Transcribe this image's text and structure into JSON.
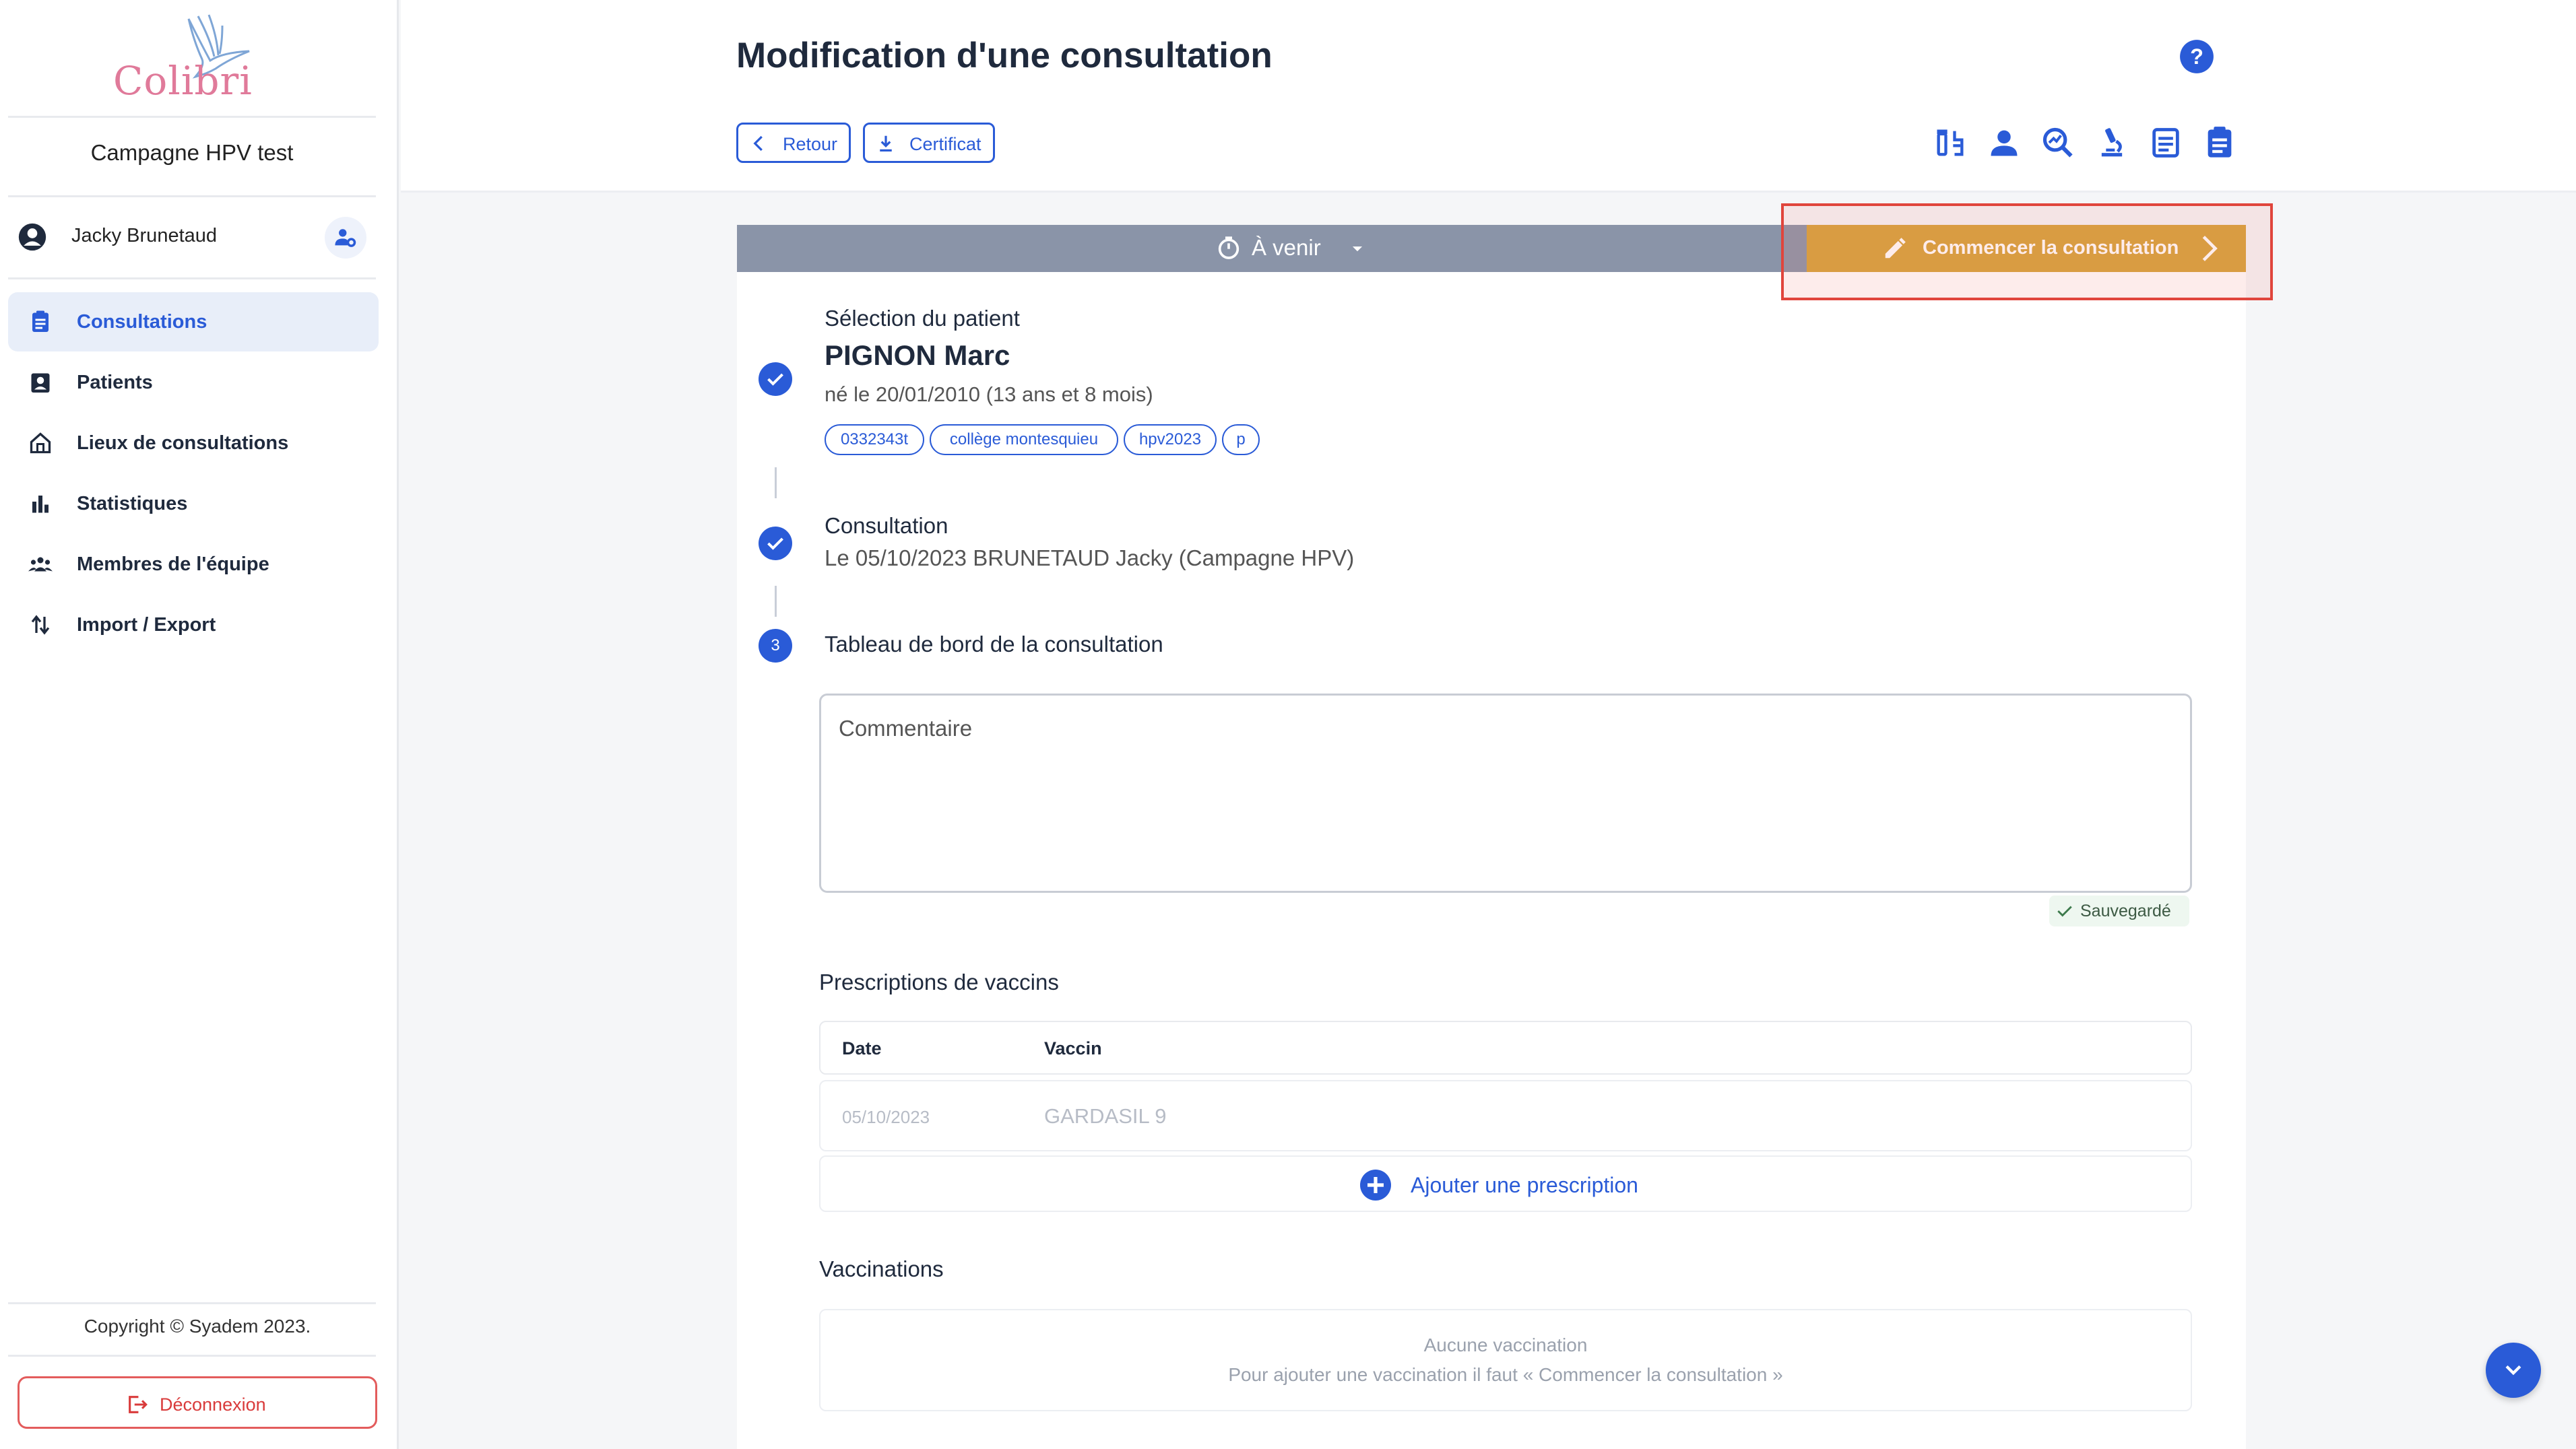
{
  "app": {
    "logo_text": "Colibri",
    "campaign": "Campagne HPV test",
    "user_name": "Jacky Brunetaud",
    "copyright": "Copyright © Syadem 2023.",
    "logout_label": "Déconnexion"
  },
  "sidebar": {
    "items": [
      {
        "label": "Consultations",
        "icon": "clipboard-icon",
        "active": true
      },
      {
        "label": "Patients",
        "icon": "patient-badge-icon"
      },
      {
        "label": "Lieux de consultations",
        "icon": "home-icon"
      },
      {
        "label": "Statistiques",
        "icon": "bar-chart-icon"
      },
      {
        "label": "Membres de l'équipe",
        "icon": "team-icon"
      },
      {
        "label": "Import / Export",
        "icon": "swap-arrows-icon"
      }
    ]
  },
  "header": {
    "title": "Modification d'une consultation",
    "back_label": "Retour",
    "certificate_label": "Certificat",
    "toolbar_icons": [
      "vaccine-icon",
      "person-icon",
      "search-analytics-icon",
      "microscope-icon",
      "document-icon",
      "clipboard-list-icon"
    ]
  },
  "status": {
    "label": "À venir",
    "start_label": "Commencer la consultation"
  },
  "colors": {
    "accent": "#2a5bd7",
    "status_bar": "#8a94a8",
    "start_button": "#d6a23b",
    "highlight": "#e0453c"
  },
  "patient_step": {
    "title": "Sélection du patient",
    "name": "PIGNON Marc",
    "birth": "né le 20/01/2010 (13 ans et 8 mois)",
    "tags": [
      "0332343t",
      "collège montesquieu",
      "hpv2023",
      "p"
    ]
  },
  "consultation_step": {
    "title": "Consultation",
    "detail": "Le 05/10/2023 BRUNETAUD Jacky (Campagne HPV)"
  },
  "dashboard_step": {
    "number": "3",
    "title": "Tableau de bord de la consultation",
    "comment_placeholder": "Commentaire",
    "saved_label": "Sauvegardé"
  },
  "prescriptions": {
    "title": "Prescriptions de vaccins",
    "columns": [
      "Date",
      "Vaccin"
    ],
    "rows": [
      {
        "date": "05/10/2023",
        "vaccine": "GARDASIL 9"
      }
    ],
    "add_label": "Ajouter une prescription"
  },
  "vaccinations": {
    "title": "Vaccinations",
    "empty_title": "Aucune vaccination",
    "empty_hint": "Pour ajouter une vaccination il faut « Commencer la consultation »"
  }
}
